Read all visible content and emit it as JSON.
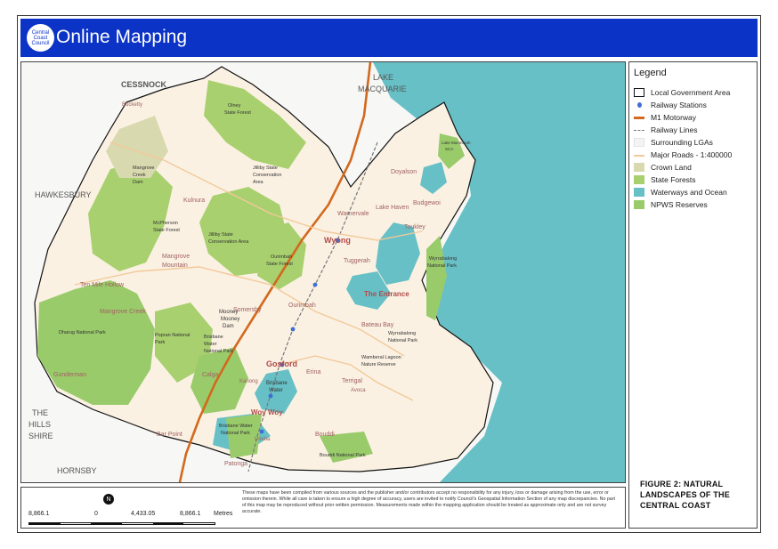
{
  "header": {
    "logo_lines": [
      "Central",
      "Coast",
      "Council"
    ],
    "title": "Online Mapping"
  },
  "map": {
    "region_labels": {
      "cessnock": "CESSNOCK",
      "lake_macquarie_1": "LAKE",
      "lake_macquarie_2": "MACQUARIE",
      "hawkesbury": "HAWKESBURY",
      "the_hills_1": "THE",
      "the_hills_2": "HILLS",
      "the_hills_3": "SHIRE",
      "hornsby": "HORNSBY"
    },
    "place_labels": {
      "wyong": "Wyong",
      "the_entrance": "The Entrance",
      "gosford": "Gosford",
      "woy_woy": "Woy Woy",
      "doyalson": "Doyalson",
      "budgewoi": "Budgewoi",
      "lake_haven": "Lake Haven",
      "warnervale": "Warnervale",
      "toukley": "Toukley",
      "tuggerah": "Tuggerah",
      "ourimbah": "Ourimbah",
      "somersby": "Somersby",
      "erina": "Erina",
      "terrigal": "Terrigal",
      "bateau_bay": "Bateau Bay",
      "kulnura": "Kulnura",
      "mangrove_mountain_1": "Mangrove",
      "mangrove_mountain_2": "Mountain",
      "ten_mile_hollow": "Ten Mile Hollow",
      "mangrove_creek": "Mangrove Creek",
      "gunderman": "Gunderman",
      "calga": "Calga",
      "bar_point": "Bar Point",
      "patonga": "Patonga",
      "bucketty": "Bucketty",
      "kariong": "Kariong",
      "avoca": "Avoca",
      "umina": "Umina",
      "bouddi": "Bouddi",
      "brisbane_water_1": "Brisbane",
      "brisbane_water_2": "Water"
    },
    "area_labels": {
      "olney_1": "Olney",
      "olney_2": "State Forest",
      "jilliby_1": "Jilliby State",
      "jilliby_2": "Conservation",
      "jilliby_3": "Area",
      "mangrove_dam_1": "Mangrove",
      "mangrove_dam_2": "Creek",
      "mangrove_dam_3": "Dam",
      "mcpherson_1": "McPherson",
      "mcpherson_2": "State Forest",
      "jilliby_b_1": "Jilliby State",
      "jilliby_b_2": "Conservation Area",
      "ourimbah_sf_1": "Ourimbah",
      "ourimbah_sf_2": "State Forest",
      "wyrrabalong_1": "Wyrrabalong",
      "wyrrabalong_2": "National Park",
      "wyrrabalong_b_1": "Wyrrabalong",
      "wyrrabalong_b_2": "National Park",
      "mooney_1": "Mooney",
      "mooney_2": "Mooney",
      "mooney_3": "Dam",
      "dharug": "Dharug National Park",
      "popran_1": "Popran National",
      "popran_2": "Park",
      "brisbane_np_1": "Brisbane",
      "brisbane_np_2": "Water",
      "brisbane_np_3": "National Park",
      "brisbane_np_b_1": "Brisbane Water",
      "brisbane_np_b_2": "National Park",
      "bouddi_np": "Bouddi National Park",
      "wamberal_1": "Wamberal Lagoon",
      "wamberal_2": "Nature Reserve",
      "munmorah_1": "Lake Munmorah",
      "munmorah_2": "SCA"
    }
  },
  "legend": {
    "title": "Legend",
    "items": [
      {
        "label": "Local Government Area",
        "symbol": "lga"
      },
      {
        "label": "Railway Stations",
        "symbol": "station"
      },
      {
        "label": "M1 Motorway",
        "symbol": "motorway"
      },
      {
        "label": "Railway Lines",
        "symbol": "railway"
      },
      {
        "label": "Surrounding LGAs",
        "symbol": "surrounding"
      },
      {
        "label": "Major Roads - 1:400000",
        "symbol": "roads"
      },
      {
        "label": "Crown Land",
        "symbol": "crown"
      },
      {
        "label": "State Forests",
        "symbol": "forest"
      },
      {
        "label": "Waterways and Ocean",
        "symbol": "water"
      },
      {
        "label": "NPWS Reserves",
        "symbol": "npws"
      }
    ],
    "colors": {
      "lga": "#111111",
      "station": "#3d6fd8",
      "motorway": "#d2691e",
      "railway": "#777777",
      "surrounding": "#f4f4f4",
      "roads": "#f2c99a",
      "crown": "#d9d9b0",
      "forest": "#a8d06e",
      "water": "#67c0c6",
      "npws": "#9acb6b",
      "land": "#fbf1e3",
      "outside": "#f7f7f5"
    },
    "figure_title": "FIGURE 2: NATURAL LANDSCAPES OF THE CENTRAL COAST"
  },
  "footer": {
    "north_label": "N",
    "scale_labels": [
      "8,866.1",
      "0",
      "4,433.05",
      "8,866.1",
      "Metres"
    ],
    "disclaimer": "These maps have been compiled from various sources and the publisher and/or contributors accept no responsibility for any injury, loss or damage arising from the use, error or omission therein. While all care is taken to ensure a high degree of accuracy, users are invited to notify Council's Geospatial Information Section of any map discrepancies. No part of this map may be reproduced without prior written permission. Measurements made within the mapping application should be treated as approximate only and are not survey accurate."
  }
}
